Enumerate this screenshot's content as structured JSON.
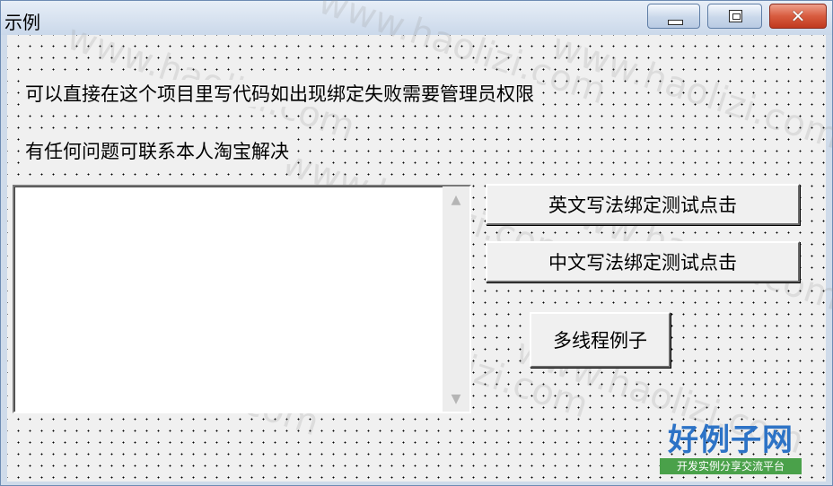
{
  "window": {
    "title": "示例",
    "controls": {
      "minimize_icon": "minimize-icon",
      "maximize_icon": "maximize-icon",
      "close_icon": "close-icon",
      "close_glyph": "✕"
    }
  },
  "labels": {
    "line1": "可以直接在这个项目里写代码如出现绑定失败需要管理员权限",
    "line2": "有任何问题可联系本人淘宝解决"
  },
  "textbox": {
    "value": "",
    "scroll_up": "▲",
    "scroll_down": "▼"
  },
  "buttons": {
    "english_bind": "英文写法绑定测试点击",
    "chinese_bind": "中文写法绑定测试点击",
    "multithread": "多线程例子"
  },
  "watermark": {
    "text": "www.haolizi.com",
    "logo_main": "好例子网",
    "logo_sub": "开发实例分享交流平台"
  }
}
